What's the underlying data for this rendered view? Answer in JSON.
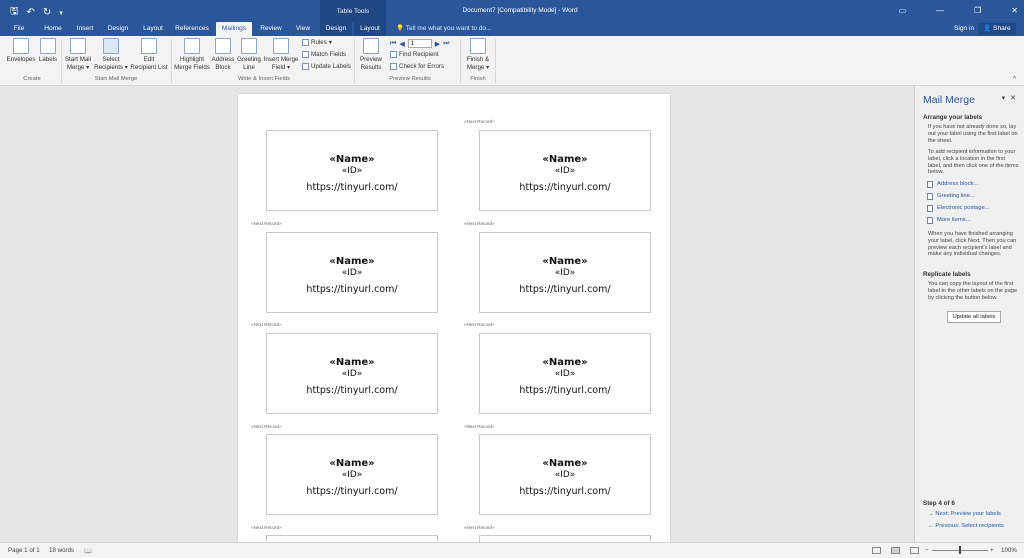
{
  "window": {
    "title": "Document7 [Compatibility Mode] - Word",
    "context_header": "Table Tools"
  },
  "quick_access": {
    "save_icon": "save-icon",
    "undo_icon": "undo-icon",
    "redo_icon": "redo-icon"
  },
  "tabs": [
    {
      "label": "File"
    },
    {
      "label": "Home"
    },
    {
      "label": "Insert"
    },
    {
      "label": "Design"
    },
    {
      "label": "Layout"
    },
    {
      "label": "References"
    },
    {
      "label": "Mailings"
    },
    {
      "label": "Review"
    },
    {
      "label": "View"
    },
    {
      "label": "Design"
    },
    {
      "label": "Layout"
    }
  ],
  "tell_me": "Tell me what you want to do...",
  "account": {
    "signin": "Sign in",
    "share": "Share"
  },
  "ribbon": {
    "create": {
      "envelopes": "Envelopes",
      "labels": "Labels",
      "group": "Create"
    },
    "start": {
      "start_mail_merge_1": "Start Mail",
      "start_mail_merge_2": "Merge",
      "select_recipients_1": "Select",
      "select_recipients_2": "Recipients",
      "edit_list_1": "Edit",
      "edit_list_2": "Recipient List",
      "group": "Start Mail Merge"
    },
    "write": {
      "highlight_1": "Highlight",
      "highlight_2": "Merge Fields",
      "address_1": "Address",
      "address_2": "Block",
      "greeting_1": "Greeting",
      "greeting_2": "Line",
      "insert_field_1": "Insert Merge",
      "insert_field_2": "Field",
      "rules": "Rules",
      "match_fields": "Match Fields",
      "update_labels": "Update Labels",
      "group": "Write & Insert Fields"
    },
    "preview": {
      "preview_1": "Preview",
      "preview_2": "Results",
      "record_value": "1",
      "find_recipient": "Find Recipient",
      "check_errors": "Check for Errors",
      "group": "Preview Results"
    },
    "finish": {
      "finish_1": "Finish &",
      "finish_2": "Merge",
      "group": "Finish"
    }
  },
  "document": {
    "next_record": "«Next Record»",
    "labels": [
      {
        "name": "«Name»",
        "id": "«ID»",
        "url": "https://tinyurl.com/"
      },
      {
        "name": "«Name»",
        "id": "«ID»",
        "url": "https://tinyurl.com/"
      },
      {
        "name": "«Name»",
        "id": "«ID»",
        "url": "https://tinyurl.com/"
      },
      {
        "name": "«Name»",
        "id": "«ID»",
        "url": "https://tinyurl.com/"
      },
      {
        "name": "«Name»",
        "id": "«ID»",
        "url": "https://tinyurl.com/"
      },
      {
        "name": "«Name»",
        "id": "«ID»",
        "url": "https://tinyurl.com/"
      },
      {
        "name": "«Name»",
        "id": "«ID»",
        "url": "https://tinyurl.com/"
      },
      {
        "name": "«Name»",
        "id": "«ID»",
        "url": "https://tinyurl.com/"
      }
    ]
  },
  "task_pane": {
    "title": "Mail Merge",
    "arrange_heading": "Arrange your labels",
    "arrange_p1": "If you have not already done so, lay out your label using the first label on the sheet.",
    "arrange_p2": "To add recipient information to your label, click a location in the first label, and then click one of the items below.",
    "links": [
      "Address block...",
      "Greeting line...",
      "Electronic postage...",
      "More items..."
    ],
    "arrange_p3": "When you have finished arranging your label, click Next. Then you can preview each recipient's label and make any individual changes.",
    "replicate_heading": "Replicate labels",
    "replicate_p": "You can copy the layout of the first label to the other labels on the page by clicking the button below.",
    "update_button": "Update all labels",
    "step": "Step 4 of 6",
    "next": "Next: Preview your labels",
    "previous": "Previous: Select recipients"
  },
  "status": {
    "page": "Page 1 of 1",
    "words": "18 words",
    "zoom": "100%"
  }
}
